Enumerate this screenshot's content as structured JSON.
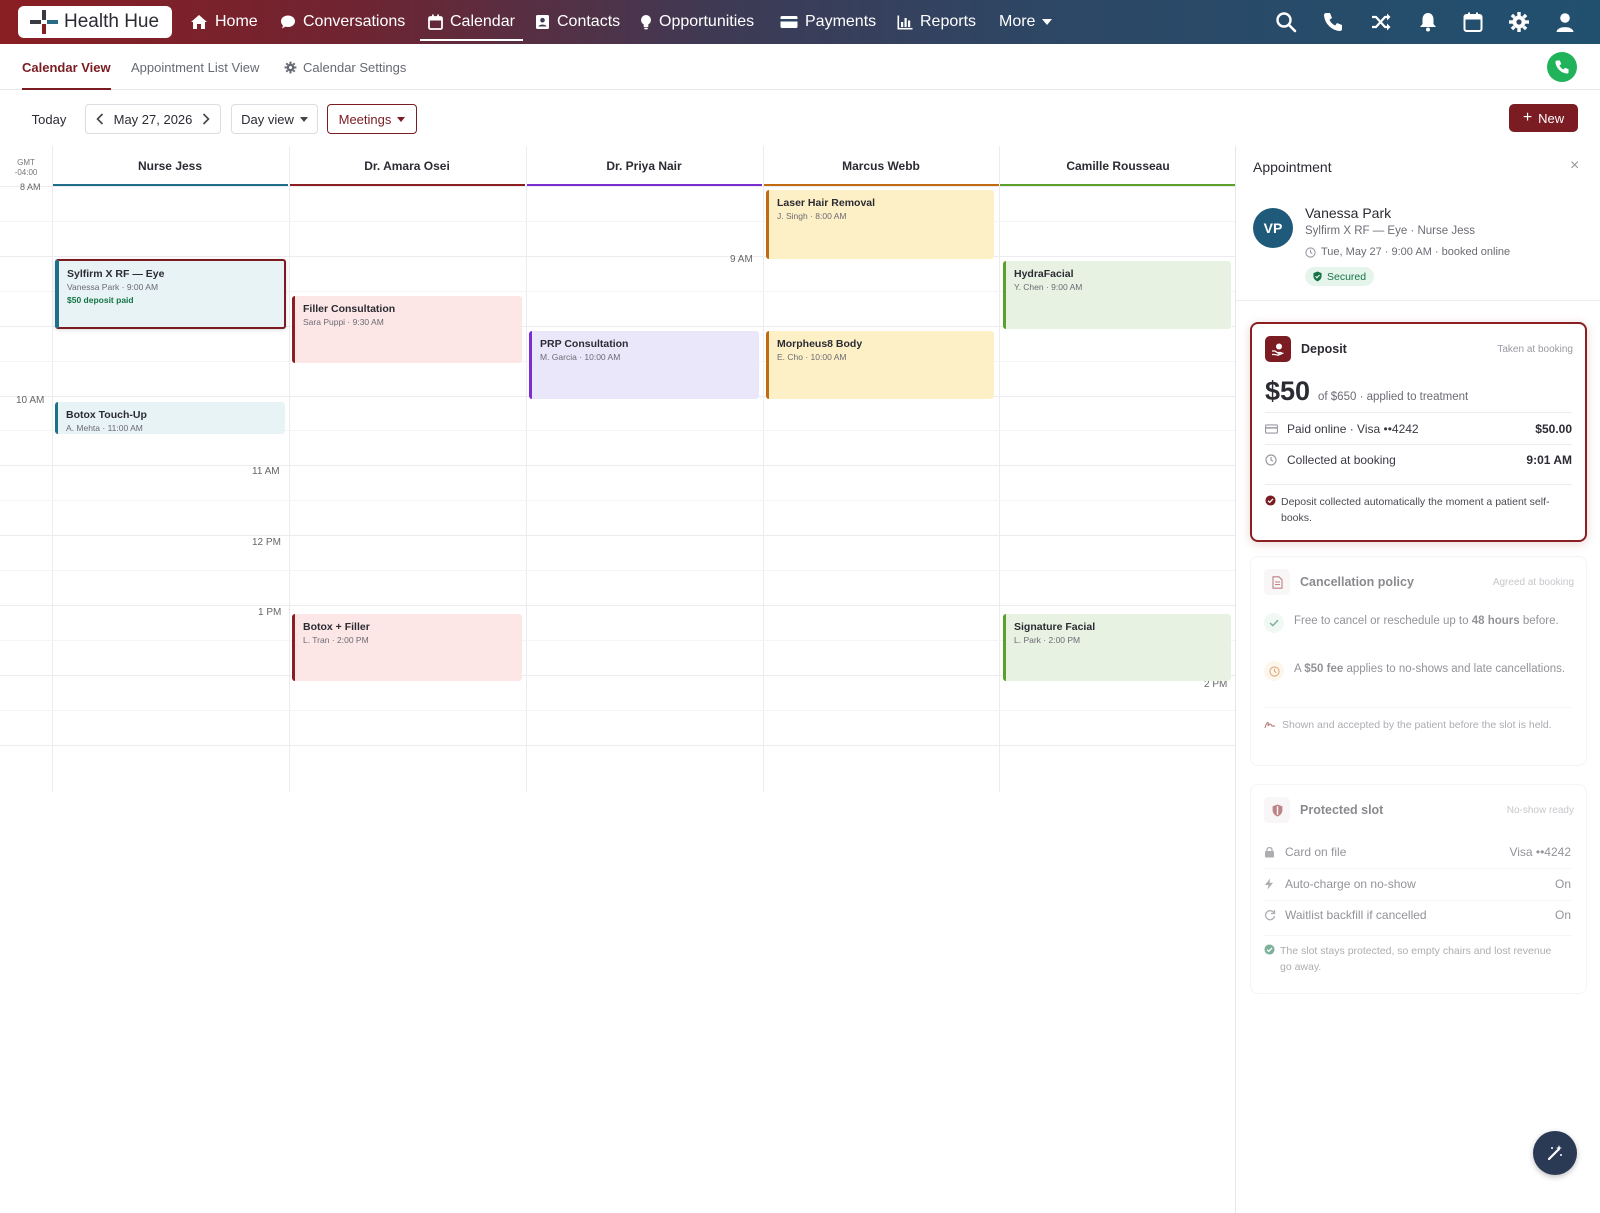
{
  "app": {
    "brand": "Health Hue"
  },
  "topnav": {
    "items": [
      {
        "label": "Home"
      },
      {
        "label": "Conversations"
      },
      {
        "label": "Calendar"
      },
      {
        "label": "Contacts"
      },
      {
        "label": "Opportunities"
      },
      {
        "label": "Payments"
      },
      {
        "label": "Reports"
      },
      {
        "label": "More"
      }
    ],
    "icons": [
      "search-icon",
      "phone-icon",
      "shuffle-icon",
      "bell-icon",
      "calendar-icon",
      "gear-icon",
      "user-icon"
    ]
  },
  "subnav": {
    "tabs": [
      {
        "label": "Calendar View"
      },
      {
        "label": "Appointment List View"
      },
      {
        "label": "Calendar Settings"
      }
    ]
  },
  "toolbar": {
    "today": "Today",
    "date": "May 27, 2026",
    "view": "Day view",
    "filter": "Meetings",
    "new": "New"
  },
  "calendar": {
    "timezone": [
      "GMT",
      "-04:00"
    ],
    "columns": [
      {
        "name": "Nurse Jess",
        "color": "#1f6f8b"
      },
      {
        "name": "Dr. Amara Osei",
        "color": "#8a1e23"
      },
      {
        "name": "Dr. Priya Nair",
        "color": "#7b2fd0"
      },
      {
        "name": "Marcus Webb",
        "color": "#c26a12"
      },
      {
        "name": "Camille Rousseau",
        "color": "#5aa02c"
      }
    ],
    "time_labels": [
      "8 AM",
      "9 AM",
      "10 AM",
      "11 AM",
      "12 PM",
      "1 PM",
      "2 PM"
    ],
    "events": [
      {
        "title": "Sylfirm X RF — Eye",
        "sub": "Vanessa Park · 9:00 AM",
        "note": "$50 deposit paid"
      },
      {
        "title": "Botox Touch-Up",
        "sub": "A. Mehta · 11:00 AM"
      },
      {
        "title": "Filler Consultation",
        "sub": "Sara Puppi · 9:30 AM"
      },
      {
        "title": "Botox + Filler",
        "sub": "L. Tran · 2:00 PM"
      },
      {
        "title": "PRP Consultation",
        "sub": "M. Garcia · 10:00 AM"
      },
      {
        "title": "Laser Hair Removal",
        "sub": "J. Singh · 8:00 AM"
      },
      {
        "title": "Morpheus8 Body",
        "sub": "E. Cho · 10:00 AM"
      },
      {
        "title": "HydraFacial",
        "sub": "Y. Chen · 9:00 AM"
      },
      {
        "title": "Signature Facial",
        "sub": "L. Park · 2:00 PM"
      }
    ]
  },
  "panel": {
    "title": "Appointment",
    "patient": {
      "initials": "VP",
      "name": "Vanessa Park",
      "service": "Sylfirm X RF — Eye · Nurse Jess",
      "when": "Tue, May 27 · 9:00 AM · booked online",
      "status": "Secured"
    },
    "deposit": {
      "title": "Deposit",
      "tag": "Taken at booking",
      "amount": "$50",
      "amount_note": "of $650 · applied to treatment",
      "rows": [
        {
          "label": "Paid online · Visa ••4242",
          "value": "$50.00"
        },
        {
          "label": "Collected at booking",
          "value": "9:01 AM"
        }
      ],
      "footnote": "Deposit collected automatically the moment a patient self-books."
    },
    "policy": {
      "title": "Cancellation policy",
      "tag": "Agreed at booking",
      "line1_pre": "Free to cancel or reschedule up to ",
      "line1_bold": "48 hours",
      "line1_post": " before.",
      "line2_pre": "A ",
      "line2_bold": "$50 fee",
      "line2_post": " applies to no-shows and late cancellations.",
      "footnote": "Shown and accepted by the patient before the slot is held."
    },
    "protected": {
      "title": "Protected slot",
      "tag": "No-show ready",
      "rows": [
        {
          "label": "Card on file",
          "value": "Visa ••4242"
        },
        {
          "label": "Auto-charge on no-show",
          "value": "On"
        },
        {
          "label": "Waitlist backfill if cancelled",
          "value": "On"
        }
      ],
      "footnote": "The slot stays protected, so empty chairs and lost revenue go away."
    }
  },
  "colors": {
    "brand": "#7a1c22",
    "call": "#21b35a",
    "avatar": "#1f5a7a"
  }
}
